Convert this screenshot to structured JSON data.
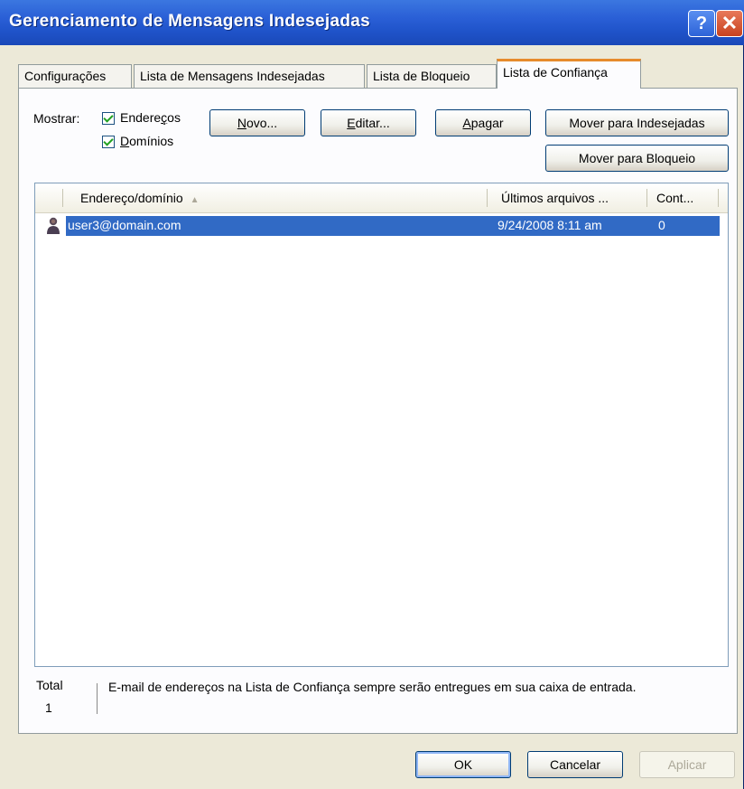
{
  "window": {
    "title": "Gerenciamento de Mensagens Indesejadas",
    "help_glyph": "?",
    "close_glyph": "✕"
  },
  "tabs": [
    {
      "label": "Configurações",
      "active": false
    },
    {
      "label": "Lista de Mensagens Indesejadas",
      "active": false
    },
    {
      "label": "Lista de Bloqueio",
      "active": false
    },
    {
      "label": "Lista de Confiança",
      "active": true
    }
  ],
  "filters": {
    "show_label": "Mostrar:",
    "addresses": {
      "label_pre": "Endere",
      "label_ul": "ç",
      "label_post": "os",
      "checked": true
    },
    "domains": {
      "label_pre": "",
      "label_ul": "D",
      "label_post": "omínios",
      "checked": true
    }
  },
  "buttons": {
    "new": {
      "ul": "N",
      "rest": "ovo..."
    },
    "edit": {
      "ul": "E",
      "rest": "ditar..."
    },
    "delete": {
      "ul": "A",
      "rest": "pagar"
    },
    "move_junk": "Mover para Indesejadas",
    "move_block": "Mover para Bloqueio"
  },
  "list": {
    "columns": [
      "Endereço/domínio",
      "Últimos arquivos ...",
      "Cont..."
    ],
    "sort_indicator": "▲",
    "rows": [
      {
        "address": "user3@domain.com",
        "last": "9/24/2008 8:11 am",
        "count": "0",
        "selected": true,
        "icon": "user-icon"
      }
    ]
  },
  "footer": {
    "total_label": "Total",
    "total_value": "1",
    "info": "E-mail de endereços na Lista de Confiança sempre serão entregues em sua caixa de entrada."
  },
  "dialog_buttons": {
    "ok": "OK",
    "cancel": "Cancelar",
    "apply": "Aplicar"
  },
  "colors": {
    "title_bar": "#2a5fd6",
    "selection": "#316ac5",
    "active_tab_accent": "#e68b2c",
    "checkmark": "#21a121"
  }
}
